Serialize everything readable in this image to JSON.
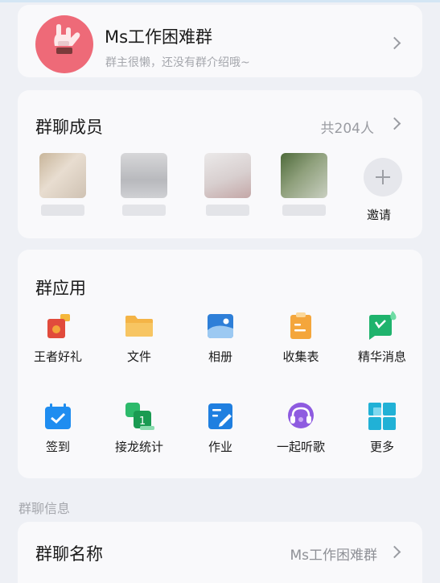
{
  "group": {
    "title": "Ms工作困难群",
    "subtitle": "群主很懒，还没有群介绍哦~"
  },
  "members": {
    "title": "群聊成员",
    "count": "共204人",
    "invite_label": "邀请"
  },
  "apps": {
    "title": "群应用",
    "items": [
      {
        "label": "王者好礼",
        "icon": "gift-icon"
      },
      {
        "label": "文件",
        "icon": "folder-icon"
      },
      {
        "label": "相册",
        "icon": "album-icon"
      },
      {
        "label": "收集表",
        "icon": "clipboard-icon"
      },
      {
        "label": "精华消息",
        "icon": "essence-message-icon"
      },
      {
        "label": "签到",
        "icon": "calendar-check-icon"
      },
      {
        "label": "接龙统计",
        "icon": "relay-stats-icon"
      },
      {
        "label": "作业",
        "icon": "homework-icon"
      },
      {
        "label": "一起听歌",
        "icon": "listen-together-icon"
      },
      {
        "label": "更多",
        "icon": "more-grid-icon"
      }
    ]
  },
  "info": {
    "section_label": "群聊信息",
    "name_label": "群聊名称",
    "name_value": "Ms工作困难群"
  },
  "colors": {
    "page_bg": "#eef0f5",
    "card_bg": "#f9f9fb",
    "avatar_pink": "#ee6a78",
    "secondary_text": "#9a9ca2"
  }
}
